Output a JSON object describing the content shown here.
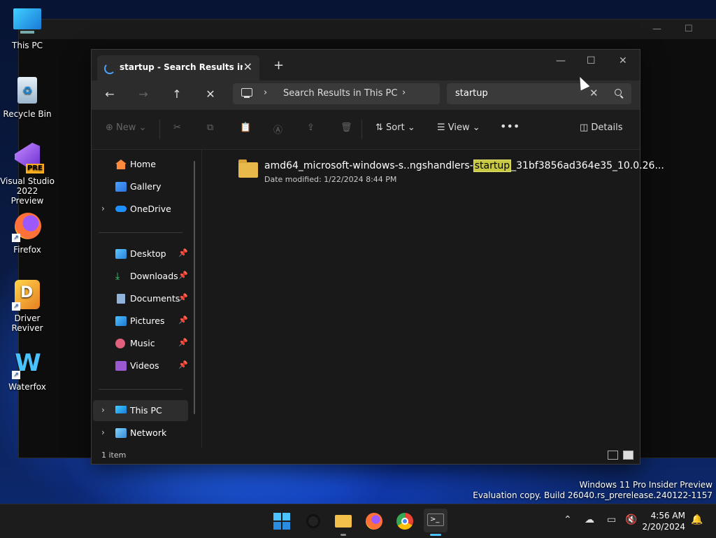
{
  "desktop": {
    "icons": [
      {
        "label": "This PC",
        "icon": "this-pc-icon"
      },
      {
        "label": "Recycle Bin",
        "icon": "recycle-bin-icon"
      },
      {
        "label": "Visual Studio 2022 Preview",
        "line1": "Visual Studio",
        "line2": "2022 Preview",
        "badge": "PRE",
        "icon": "visual-studio-icon"
      },
      {
        "label": "Firefox",
        "icon": "firefox-icon"
      },
      {
        "label": "Driver Reviver",
        "icon": "driver-reviver-icon"
      },
      {
        "label": "Waterfox",
        "icon": "waterfox-icon"
      }
    ]
  },
  "explorer": {
    "tab_title": "startup - Search Results in This",
    "address": {
      "crumb": "Search Results in This PC"
    },
    "search": {
      "value": "startup"
    },
    "toolbar": {
      "new_label": "New",
      "sort_label": "Sort",
      "view_label": "View",
      "details_label": "Details"
    },
    "sidebar": {
      "home": "Home",
      "gallery": "Gallery",
      "onedrive": "OneDrive",
      "desktop": "Desktop",
      "downloads": "Downloads",
      "documents": "Documents",
      "pictures": "Pictures",
      "music": "Music",
      "videos": "Videos",
      "this_pc": "This PC",
      "network": "Network"
    },
    "results": [
      {
        "name_prefix": "amd64_microsoft-windows-s..ngshandlers-",
        "name_match": "startup",
        "name_suffix": "_31bf3856ad364e35_10.0.26...",
        "meta_label": "Date modified:",
        "meta_value": "1/22/2024 8:44 PM"
      }
    ],
    "status": {
      "count": "1 item"
    }
  },
  "watermark": {
    "line1": "Windows 11 Pro Insider Preview",
    "line2": "Evaluation copy. Build 26040.rs_prerelease.240122-1157"
  },
  "taskbar": {
    "time": "4:56 AM",
    "date": "2/20/2024"
  },
  "colors": {
    "accent": "#4aa3ff",
    "search_highlight": "#c8c843",
    "folder": "#e8b84a"
  }
}
